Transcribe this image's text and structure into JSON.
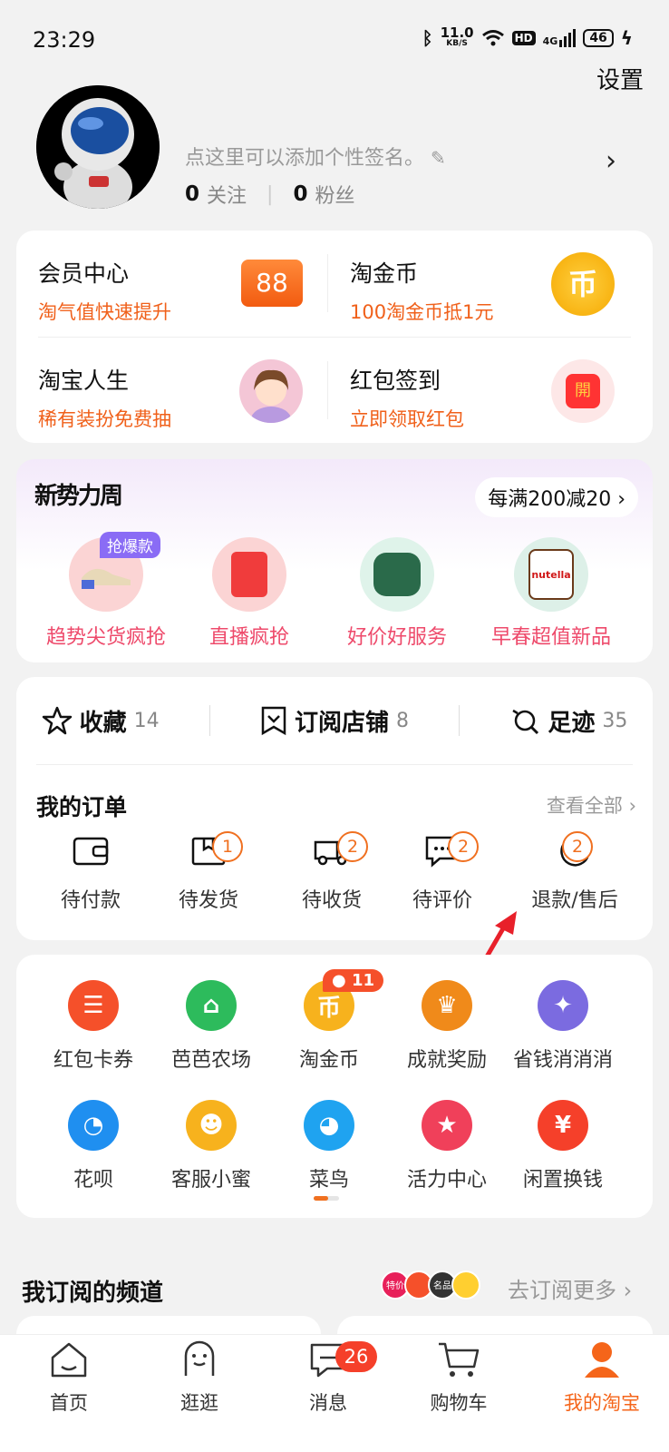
{
  "status_bar": {
    "time": "23:29",
    "net_speed": "11.0",
    "net_unit": "KB/S",
    "hd": "HD",
    "network": "4G",
    "battery": "46"
  },
  "header": {
    "settings": "设置",
    "signature": "点这里可以添加个性签名。",
    "following_count": "0",
    "following_label": "关注",
    "fans_count": "0",
    "fans_label": "粉丝"
  },
  "member": {
    "items": [
      {
        "title": "会员中心",
        "subtitle": "淘气值快速提升",
        "icon_text": "88"
      },
      {
        "title": "淘金币",
        "subtitle": "100淘金币抵1元",
        "icon_text": "币"
      },
      {
        "title": "淘宝人生",
        "subtitle": "稀有装扮免费抽"
      },
      {
        "title": "红包签到",
        "subtitle": "立即领取红包",
        "icon_text": "開"
      }
    ]
  },
  "promo": {
    "title": "新势力周",
    "deal": "每满200减20",
    "hot_tag": "抢爆款",
    "items": [
      {
        "label": "趋势尖货疯抢"
      },
      {
        "label": "直播疯抢"
      },
      {
        "label": "好价好服务"
      },
      {
        "label": "早春超值新品"
      }
    ],
    "jar_text": "nutella"
  },
  "tools": [
    {
      "label": "收藏",
      "count": "14"
    },
    {
      "label": "订阅店铺",
      "count": "8"
    },
    {
      "label": "足迹",
      "count": "35"
    }
  ],
  "orders": {
    "title": "我的订单",
    "view_all": "查看全部",
    "items": [
      {
        "label": "待付款",
        "badge": ""
      },
      {
        "label": "待发货",
        "badge": "1"
      },
      {
        "label": "待收货",
        "badge": "2"
      },
      {
        "label": "待评价",
        "badge": "2"
      },
      {
        "label": "退款/售后",
        "badge": "2"
      }
    ]
  },
  "services": {
    "coin_badge": "11",
    "row1": [
      {
        "label": "红包卡券",
        "color": "#f5502a"
      },
      {
        "label": "芭芭农场",
        "color": "#2dbb5c"
      },
      {
        "label": "淘金币",
        "color": "#f7b21d"
      },
      {
        "label": "成就奖励",
        "color": "#f08a1a"
      },
      {
        "label": "省钱消消消",
        "color": "#7b6be0"
      }
    ],
    "row2": [
      {
        "label": "花呗",
        "color": "#1f8ff0"
      },
      {
        "label": "客服小蜜",
        "color": "#f7b21d"
      },
      {
        "label": "菜鸟",
        "color": "#1fa3f0"
      },
      {
        "label": "活力中心",
        "color": "#f0405a"
      },
      {
        "label": "闲置换钱",
        "color": "#f5402a"
      }
    ]
  },
  "channels": {
    "title": "我订阅的频道",
    "more": "去订阅更多",
    "mini_tags": [
      "特价",
      "",
      "名品",
      ""
    ]
  },
  "tabbar": {
    "messages_badge": "26",
    "items": [
      {
        "label": "首页"
      },
      {
        "label": "逛逛"
      },
      {
        "label": "消息"
      },
      {
        "label": "购物车"
      },
      {
        "label": "我的淘宝"
      }
    ]
  },
  "colors": {
    "accent": "#f0601a",
    "promo_pink": "#ee4a6b",
    "badge_orange": "#f07020"
  }
}
